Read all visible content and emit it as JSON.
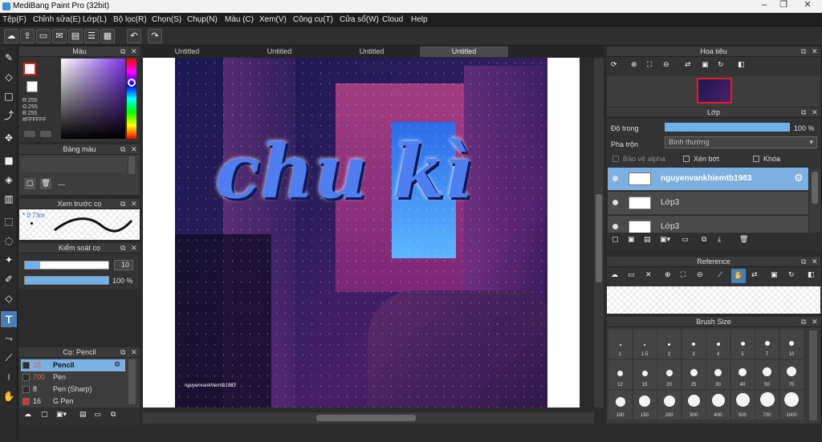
{
  "window": {
    "title": "MediBang Paint Pro (32bit)"
  },
  "menu": [
    "Tệp(F)",
    "Chỉnh sửa(E)",
    "Lớp(L)",
    "Bộ lọc(R)",
    "Chọn(S)",
    "Chụp(N)",
    "Màu (C)",
    "Xem(V)",
    "Công cụ(T)",
    "Cửa sổ(W)",
    "Cloud",
    "Help"
  ],
  "tabs": [
    "Untitled",
    "Untitled",
    "Untitled",
    "Untitled"
  ],
  "color_panel": {
    "title": "Màu",
    "r": "R:255",
    "g": "G:255",
    "b": "B:255",
    "hex": "#FFFFFF"
  },
  "palette_panel": {
    "title": "Bảng màu",
    "value": "---"
  },
  "brush_preview": {
    "title": "Xem trước cọ",
    "size": "0.73m"
  },
  "brush_control": {
    "title": "Kiểm soát cọ",
    "size": "10",
    "opacity": "100 %"
  },
  "brush_list": {
    "title": "Cọ: Pencil",
    "items": [
      {
        "num": "10",
        "name": "Pencil",
        "color": "#2a2a2a",
        "selected": true
      },
      {
        "num": "700",
        "name": "Pen",
        "color": "#2a2a2a",
        "selected": false
      },
      {
        "num": "8",
        "name": "Pen (Sharp)",
        "color": "#2a2a2a",
        "selected": false
      },
      {
        "num": "16",
        "name": "G Pen",
        "color": "#e03030",
        "selected": false
      }
    ]
  },
  "navigator": {
    "title": "Hoa tiêu"
  },
  "layer_panel": {
    "title": "Lớp",
    "opacity_label": "Độ trong",
    "opacity_value": "100 %",
    "blend_label": "Pha trộn",
    "blend_value": "Bình thường",
    "protect_alpha": "Bảo vệ alpha",
    "clip": "Xén bớt",
    "lock": "Khóa",
    "layers": [
      {
        "name": "nguyenvankhiemtb1983",
        "selected": true
      },
      {
        "name": "Lớp3",
        "selected": false
      },
      {
        "name": "Lớp3",
        "selected": false
      }
    ]
  },
  "reference": {
    "title": "Reference"
  },
  "brush_size": {
    "title": "Brush Size",
    "sizes": [
      "1",
      "1.5",
      "2",
      "3",
      "4",
      "5",
      "7",
      "10",
      "12",
      "15",
      "20",
      "25",
      "30",
      "40",
      "50",
      "70",
      "100",
      "150",
      "200",
      "300",
      "400",
      "500",
      "700",
      "1000"
    ]
  },
  "artwork": {
    "title_text": "chu kì",
    "signature": "nguyenvankhiemtb1983"
  }
}
